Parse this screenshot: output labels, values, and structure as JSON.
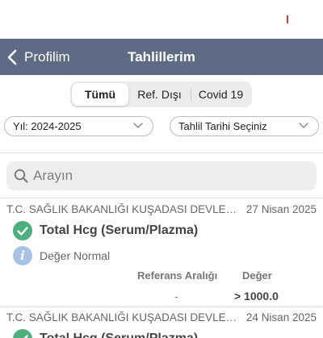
{
  "nav": {
    "back_label": "Profilim",
    "title": "Tahlillerim"
  },
  "segments": [
    {
      "label": "Tümü",
      "active": true
    },
    {
      "label": "Ref. Dışı",
      "active": false
    },
    {
      "label": "Covid 19",
      "active": false
    }
  ],
  "filters": {
    "year": "Yıl: 2024-2025",
    "date": "Tahlil Tarihi Seçiniz"
  },
  "search": {
    "placeholder": "Arayın"
  },
  "results": [
    {
      "hospital": "T.C. SAĞLIK BAKANLIĞI KUŞADASI DEVLET H...",
      "date": "27 Nisan 2025",
      "test": "Total Hcg (Serum/Plazma)",
      "status": "Değer Normal",
      "ref_header": "Referans Aralığı",
      "value_header": "Değer",
      "ref": "-",
      "value": "> 1000.0"
    },
    {
      "hospital": "T.C. SAĞLIK BAKANLIĞI KUŞADASI DEVLET H...",
      "date": "24 Nisan 2025",
      "test": "Total Hcg (Serum/Plazma)"
    }
  ],
  "colors": {
    "navbar": "#5f6b84",
    "check": "#4caf7d",
    "info": "#a9c3e6"
  }
}
